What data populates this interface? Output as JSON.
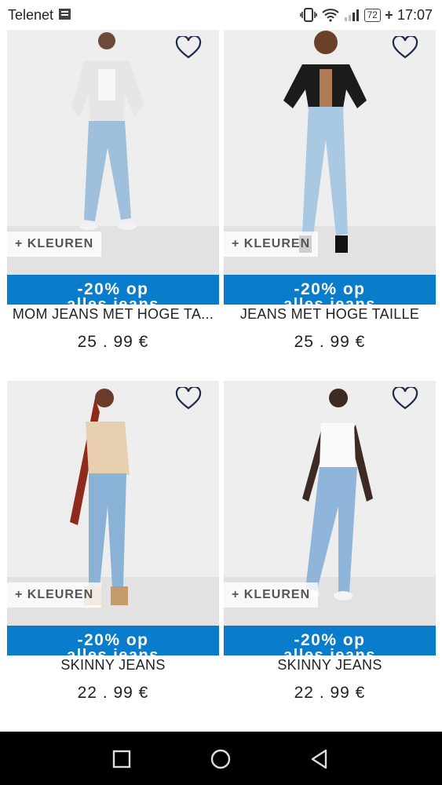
{
  "status_bar": {
    "carrier": "Telenet",
    "battery": "72",
    "time": "17:07"
  },
  "products": [
    {
      "name": "MOM JEANS MET HOGE TA...",
      "price": "25 . 99 €",
      "promo": "-20% op",
      "promo_clipped": "alles jeans",
      "colors_label": "+ KLEUREN",
      "top_color": "#e6e6e6",
      "garment": "#9fc0dc"
    },
    {
      "name": "JEANS MET HOGE TAILLE",
      "price": "25 . 99 €",
      "promo": "-20% op",
      "promo_clipped": "alles jeans",
      "colors_label": "+ KLEUREN",
      "top_color": "#1b1b1b",
      "garment": "#a9c8e2"
    },
    {
      "name": "SKINNY JEANS",
      "price": "22 . 99 €",
      "promo": "-20% op",
      "promo_clipped": "alles jeans",
      "colors_label": "+ KLEUREN",
      "top_color": "#e8cfb0",
      "garment": "#89b2d6"
    },
    {
      "name": "SKINNY JEANS",
      "price": "22 . 99 €",
      "promo": "-20% op",
      "promo_clipped": "alles jeans",
      "colors_label": "+ KLEUREN",
      "top_color": "#fafafa",
      "garment": "#8fb6da"
    }
  ],
  "colors": {
    "promo_bg": "#0a7ccc",
    "heart": "#1e2a4a"
  },
  "nav_bar": {
    "icons": [
      "square-icon",
      "circle-icon",
      "triangle-back-icon"
    ]
  }
}
